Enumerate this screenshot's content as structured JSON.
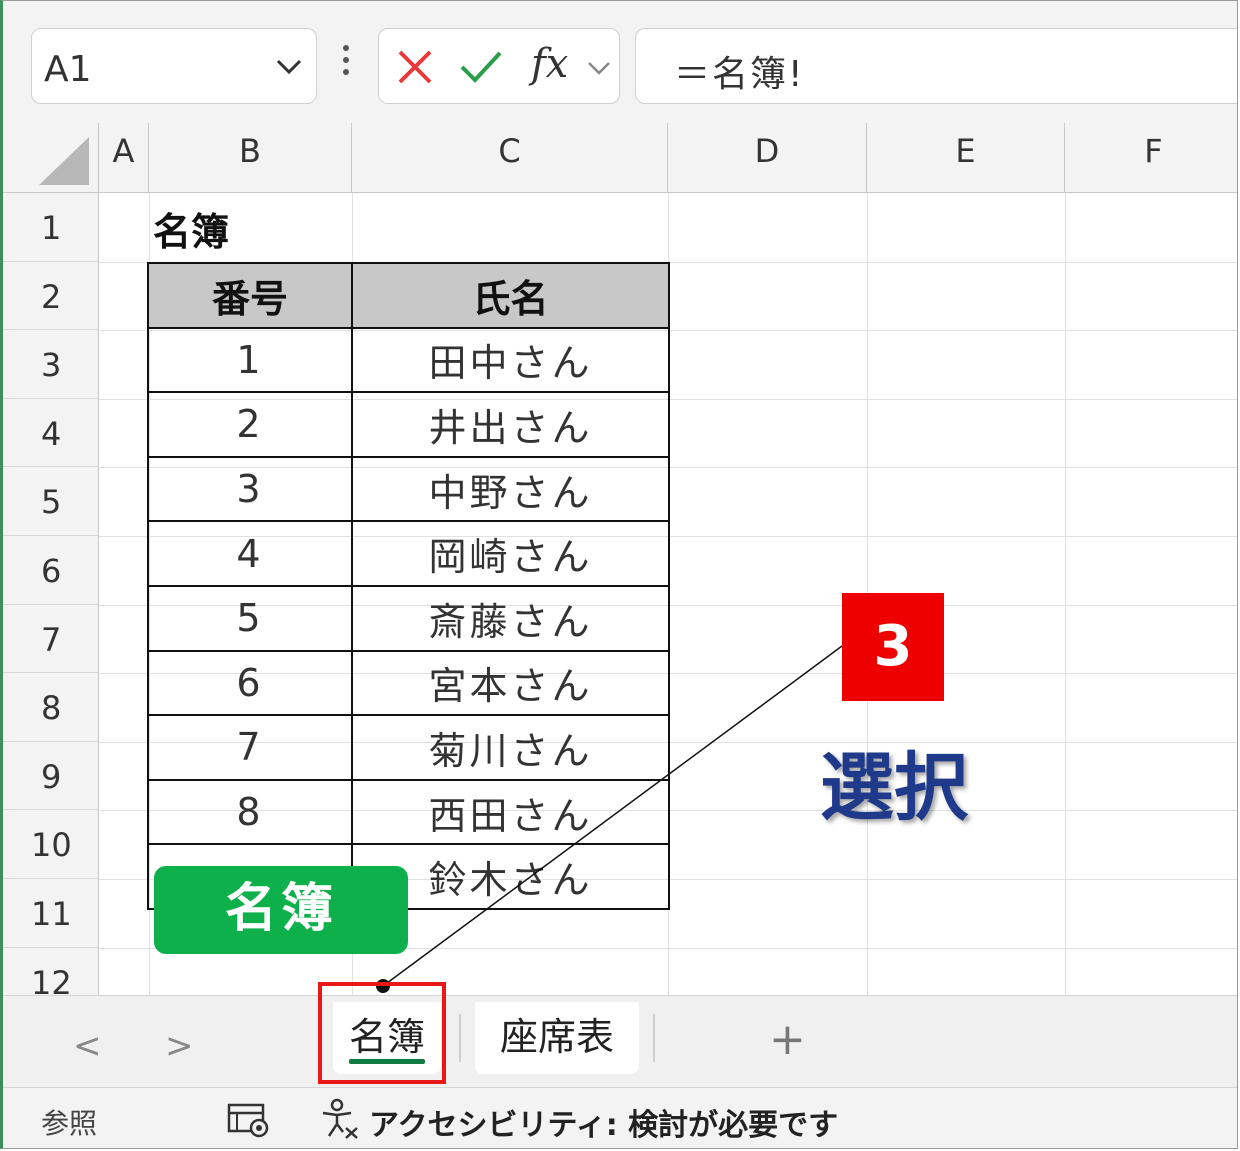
{
  "formula_bar": {
    "name_box": "A1",
    "formula": "＝名簿!"
  },
  "columns": [
    "A",
    "B",
    "C",
    "D",
    "E",
    "F"
  ],
  "rows": [
    "1",
    "2",
    "3",
    "4",
    "5",
    "6",
    "7",
    "8",
    "9",
    "10",
    "11",
    "12"
  ],
  "sheet": {
    "title": "名簿",
    "header": [
      "番号",
      "氏名"
    ],
    "rows": [
      [
        "1",
        "田中さん"
      ],
      [
        "2",
        "井出さん"
      ],
      [
        "3",
        "中野さん"
      ],
      [
        "4",
        "岡崎さん"
      ],
      [
        "5",
        "斎藤さん"
      ],
      [
        "6",
        "宮本さん"
      ],
      [
        "7",
        "菊川さん"
      ],
      [
        "8",
        "西田さん"
      ],
      [
        "",
        "鈴木さん"
      ]
    ]
  },
  "tabs": {
    "active": "名簿",
    "second": "座席表",
    "add": "+",
    "prev": "<",
    "next": ">"
  },
  "status_bar": {
    "mode": "参照",
    "accessibility": "アクセシビリティ: 検討が必要です"
  },
  "annotations": {
    "green_label": "名簿",
    "step_number": "3",
    "action_label": "選択",
    "colors": {
      "highlight": "#e81818",
      "green": "#0db04b",
      "step": "#ee0000",
      "action": "#1f3a8a"
    }
  }
}
